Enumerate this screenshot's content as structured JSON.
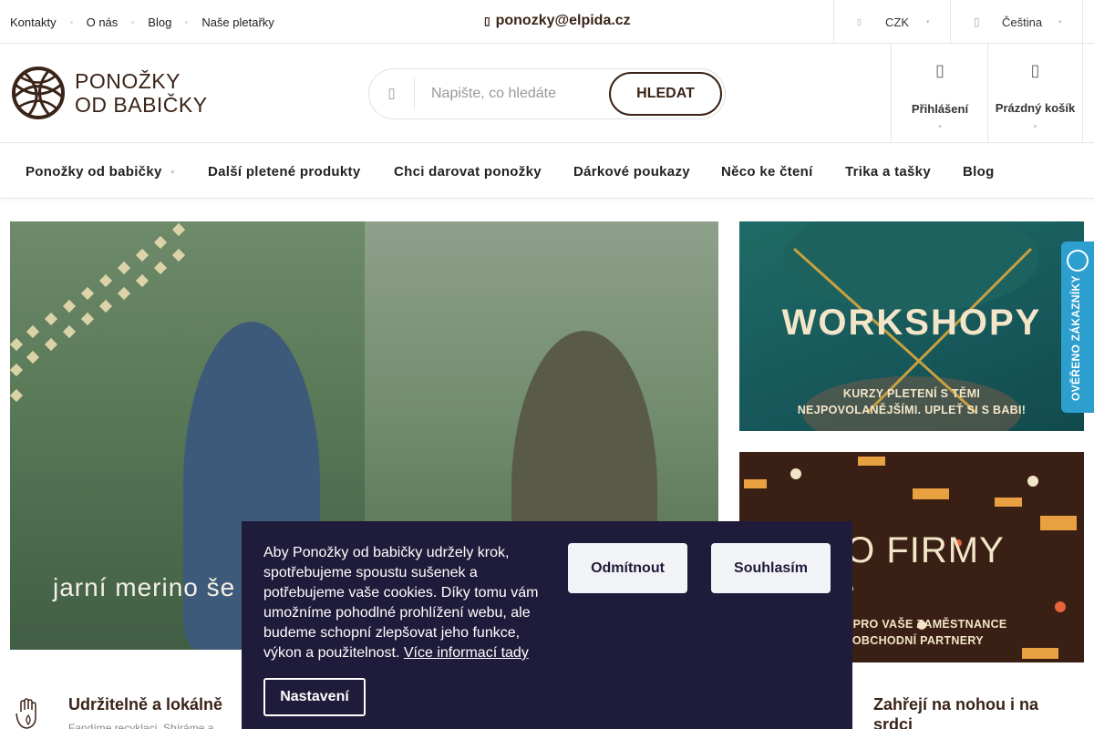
{
  "topbar": {
    "links": [
      "Kontakty",
      "O nás",
      "Blog",
      "Naše pletařky"
    ],
    "email": "ponozky@elpida.cz",
    "currency": "CZK",
    "language": "Čeština"
  },
  "header": {
    "logo_line1": "PONOŽKY",
    "logo_line2": "OD BABIČKY",
    "search_placeholder": "Napište, co hledáte",
    "search_button": "HLEDAT",
    "login_label": "Přihlášení",
    "cart_label": "Prázdný košík"
  },
  "nav": {
    "items": [
      "Ponožky od babičky",
      "Další pletené produkty",
      "Chci darovat ponožky",
      "Dárkové poukazy",
      "Něco ke čtení",
      "Trika a tašky",
      "Blog"
    ]
  },
  "hero": {
    "text": "jarní merino še"
  },
  "banners": {
    "workshop_title": "WORKSHOPY",
    "workshop_sub_line1": "KURZY PLETENÍ S TĚMI",
    "workshop_sub_line2": "NEJPOVOLANĚJŠÍMI. UPLEŤ SI S BABI!",
    "firms_title": "RO FIRMY",
    "firms_sub_line1": "ARKY PRO VAŠE ZAMĚSTNANCE",
    "firms_sub_line2": "O OBCHODNÍ PARTNERY"
  },
  "badge": {
    "text": "OVĚŘENO ZÁKAZNÍKY"
  },
  "features": [
    {
      "title": "Udržitelně a lokálně",
      "text": "Fandíme recyklaci. Shíráme a"
    },
    {
      "title_line1": "Zahřejí na nohou i na",
      "title_line2": "srdci"
    }
  ],
  "cookie": {
    "text": "Aby Ponožky od babičky udržely krok, spotřebujeme spoustu sušenek a potřebujeme vaše cookies. Díky tomu vám umožníme pohodlné prohlížení webu, ale budeme schopní zlepšovat jeho funkce, výkon a použitelnost.",
    "more_link": "Více informací tady",
    "reject": "Odmítnout",
    "accept": "Souhlasím",
    "settings": "Nastavení"
  },
  "colors": {
    "brand_brown": "#3a2418",
    "cookie_bg": "#1f1b3a",
    "badge_blue": "#2d9fcf",
    "workshop_teal": "#1f6b66"
  }
}
